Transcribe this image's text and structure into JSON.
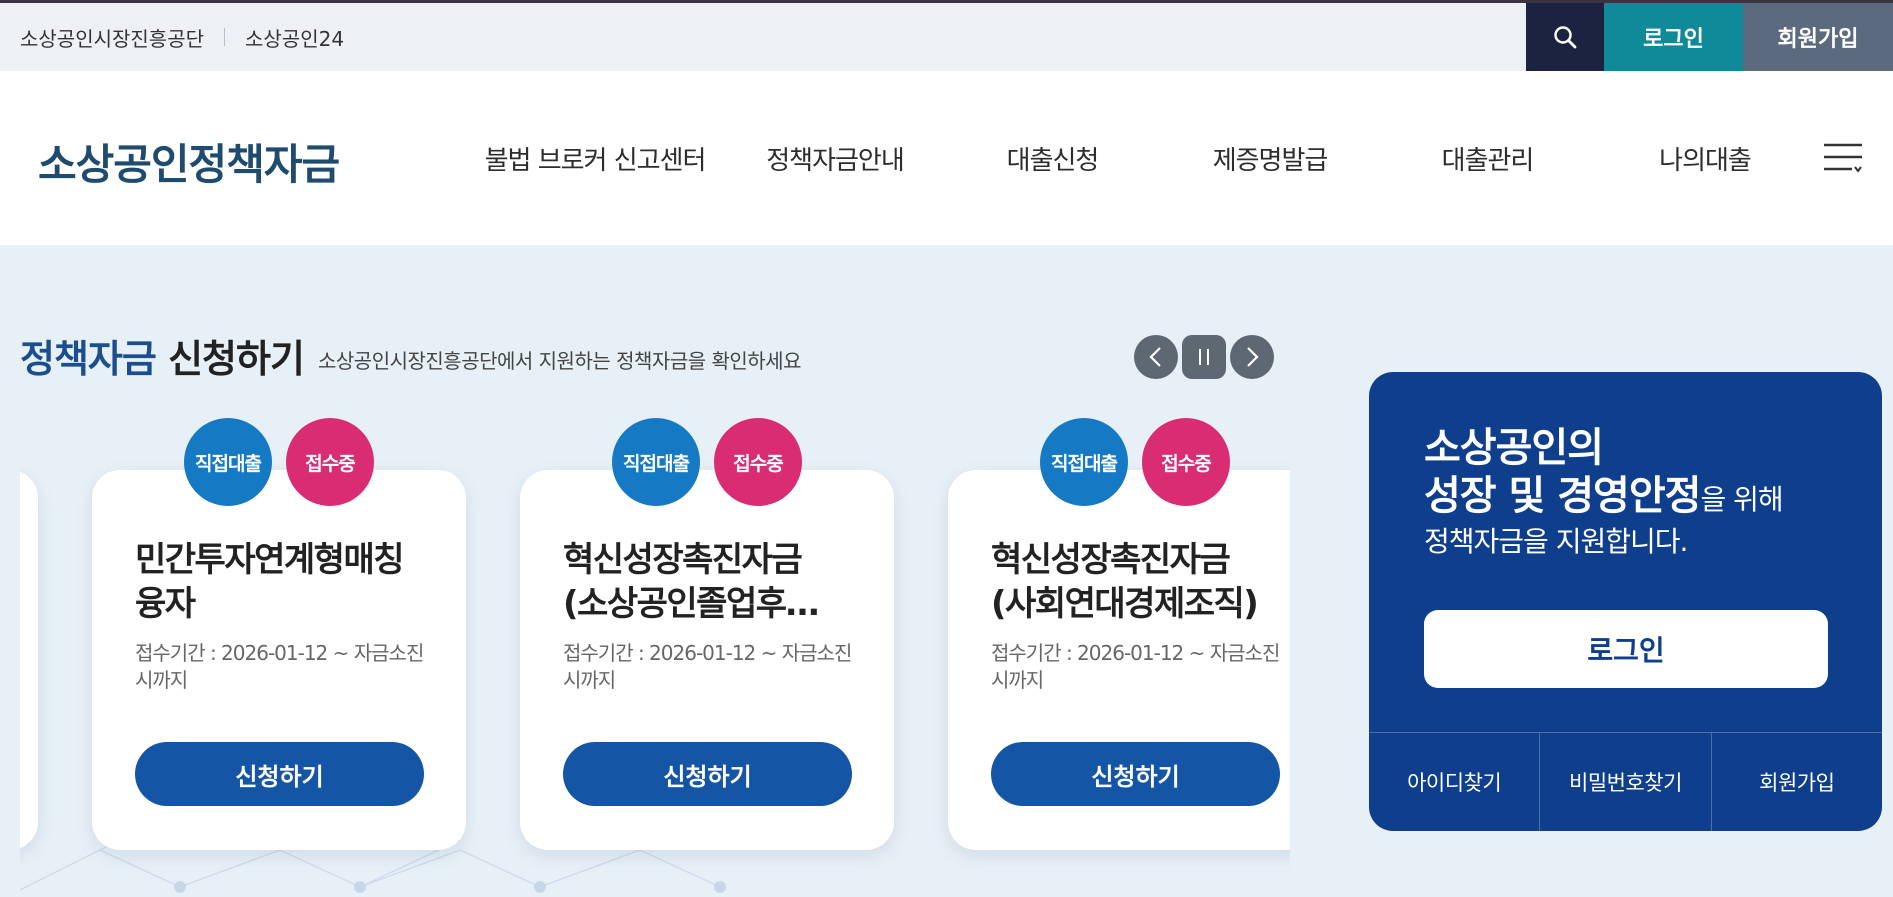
{
  "utility": {
    "links": [
      "소상공인시장진흥공단",
      "소상공인24"
    ],
    "login": "로그인",
    "join": "회원가입"
  },
  "header": {
    "logo": "소상공인정책자금",
    "nav": [
      "불법 브로커 신고센터",
      "정책자금안내",
      "대출신청",
      "제증명발급",
      "대출관리",
      "나의대출"
    ]
  },
  "section": {
    "title_accent": "정책자금",
    "title_rest": "신청하기",
    "subtitle": "소상공인시장진흥공단에서 지원하는 정책자금을 확인하세요"
  },
  "cards": [
    {
      "badge_type": "직접대출",
      "badge_status": "접수중",
      "title_lines": [
        "민간투자연계형매칭",
        "융자"
      ],
      "period_lines": [
        "접수기간 : 2026-01-12 ~ 자금소진",
        "시까지"
      ],
      "button": "신청하기"
    },
    {
      "badge_type": "직접대출",
      "badge_status": "접수중",
      "title_lines": [
        "혁신성장촉진자금",
        "(소상공인졸업후…"
      ],
      "period_lines": [
        "접수기간 : 2026-01-12 ~ 자금소진",
        "시까지"
      ],
      "button": "신청하기"
    },
    {
      "badge_type": "직접대출",
      "badge_status": "접수중",
      "title_lines": [
        "혁신성장촉진자금",
        "(사회연대경제조직)"
      ],
      "period_lines": [
        "접수기간 : 2026-01-12 ~ 자금소진",
        "시까지"
      ],
      "button": "신청하기"
    }
  ],
  "login_panel": {
    "line1": "소상공인의",
    "line2_bold": "성장 및 경영안정",
    "line2_small": "을 위해",
    "line3": "정책자금을 지원합니다.",
    "login_button": "로그인",
    "links": [
      "아이디찾기",
      "비밀번호찾기",
      "회원가입"
    ]
  },
  "colors": {
    "brand_navy": "#0f3f8c",
    "teal": "#0e8a98",
    "badge_blue": "#1679c4",
    "badge_pink": "#d92c72",
    "apply_blue": "#1555a5"
  }
}
